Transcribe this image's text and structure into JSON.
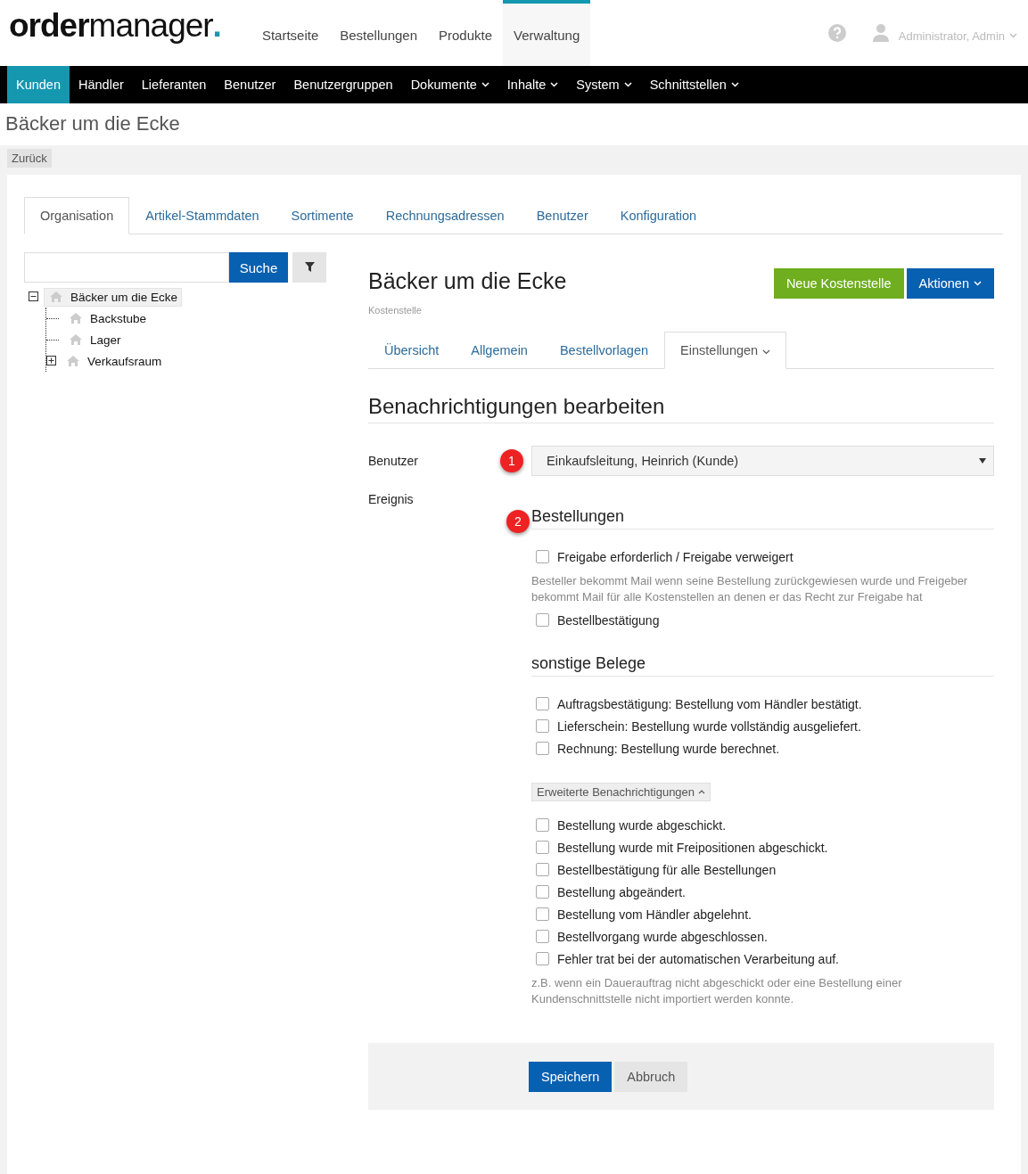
{
  "logo": {
    "bold": "order",
    "light": "manager",
    "dot": "."
  },
  "top_nav": [
    {
      "label": "Startseite",
      "selected": false
    },
    {
      "label": "Bestellungen",
      "selected": false
    },
    {
      "label": "Produkte",
      "selected": false
    },
    {
      "label": "Verwaltung",
      "selected": true
    }
  ],
  "user_menu": {
    "label": "Administrator, Admin"
  },
  "sub_nav": [
    {
      "label": "Kunden",
      "selected": true,
      "dropdown": false
    },
    {
      "label": "Händler",
      "selected": false,
      "dropdown": false
    },
    {
      "label": "Lieferanten",
      "selected": false,
      "dropdown": false
    },
    {
      "label": "Benutzer",
      "selected": false,
      "dropdown": false
    },
    {
      "label": "Benutzergruppen",
      "selected": false,
      "dropdown": false
    },
    {
      "label": "Dokumente",
      "selected": false,
      "dropdown": true
    },
    {
      "label": "Inhalte",
      "selected": false,
      "dropdown": true
    },
    {
      "label": "System",
      "selected": false,
      "dropdown": true
    },
    {
      "label": "Schnittstellen",
      "selected": false,
      "dropdown": true
    }
  ],
  "page_title": "Bäcker um die Ecke",
  "back_button": "Zurück",
  "tabs": [
    {
      "label": "Organisation",
      "selected": true
    },
    {
      "label": "Artikel-Stammdaten",
      "selected": false
    },
    {
      "label": "Sortimente",
      "selected": false
    },
    {
      "label": "Rechnungsadressen",
      "selected": false
    },
    {
      "label": "Benutzer",
      "selected": false
    },
    {
      "label": "Konfiguration",
      "selected": false
    }
  ],
  "search": {
    "button": "Suche"
  },
  "tree": [
    {
      "label": "Bäcker um die Ecke",
      "selected": true,
      "expanded": true,
      "children": [
        {
          "label": "Backstube",
          "selected": false
        },
        {
          "label": "Lager",
          "selected": false
        },
        {
          "label": "Verkaufsraum",
          "selected": false,
          "expanded": false
        }
      ]
    }
  ],
  "detail": {
    "title": "Bäcker um die Ecke",
    "subtitle": "Kostenstelle",
    "buttons": [
      {
        "label": "Neue Kostenstelle",
        "kind": "success"
      },
      {
        "label": "Aktionen",
        "kind": "primary",
        "dropdown": true
      }
    ],
    "tabs": [
      {
        "label": "Übersicht",
        "selected": false,
        "dropdown": false
      },
      {
        "label": "Allgemein",
        "selected": false,
        "dropdown": false
      },
      {
        "label": "Bestellvorlagen",
        "selected": false,
        "dropdown": false
      },
      {
        "label": "Einstellungen",
        "selected": true,
        "dropdown": true
      }
    ],
    "section_title": "Benachrichtigungen bearbeiten",
    "user_label": "Benutzer",
    "user_badge": "1",
    "user_value": "Einkaufsleitung, Heinrich (Kunde)",
    "event_label": "Ereignis",
    "groups": [
      {
        "kind": "heading",
        "title": "Bestellungen",
        "badge": "2",
        "items": [
          {
            "kind": "checkbox",
            "label": "Freigabe erforderlich / Freigabe verweigert",
            "checked": false
          },
          {
            "kind": "hint",
            "text": "Besteller bekommt Mail wenn seine Bestellung zurückgewiesen wurde und Freigeber bekommt Mail für alle Kostenstellen an denen er das Recht zur Freigabe hat"
          },
          {
            "kind": "checkbox",
            "label": "Bestellbestätigung",
            "checked": false
          }
        ]
      },
      {
        "kind": "heading",
        "title": "sonstige Belege",
        "items": [
          {
            "kind": "checkbox",
            "label": "Auftragsbestätigung: Bestellung vom Händler bestätigt.",
            "checked": false
          },
          {
            "kind": "checkbox",
            "label": "Lieferschein: Bestellung wurde vollständig ausgeliefert.",
            "checked": false
          },
          {
            "kind": "checkbox",
            "label": "Rechnung: Bestellung wurde berechnet.",
            "checked": false
          }
        ]
      },
      {
        "kind": "toggle",
        "title": "Erweiterte Benachrichtigungen",
        "expanded": true,
        "items": [
          {
            "kind": "checkbox",
            "label": "Bestellung wurde abgeschickt.",
            "checked": false
          },
          {
            "kind": "checkbox",
            "label": "Bestellung wurde mit Freipositionen abgeschickt.",
            "checked": false
          },
          {
            "kind": "checkbox",
            "label": "Bestellbestätigung für alle Bestellungen",
            "checked": false
          },
          {
            "kind": "checkbox",
            "label": "Bestellung abgeändert.",
            "checked": false
          },
          {
            "kind": "checkbox",
            "label": "Bestellung vom Händler abgelehnt.",
            "checked": false
          },
          {
            "kind": "checkbox",
            "label": "Bestellvorgang wurde abgeschlossen.",
            "checked": false
          },
          {
            "kind": "checkbox",
            "label": "Fehler trat bei der automatischen Verarbeitung auf.",
            "checked": false
          },
          {
            "kind": "hint",
            "text": "z.B. wenn ein Dauerauftrag nicht abgeschickt oder eine Bestellung einer Kundenschnittstelle nicht importiert werden konnte."
          }
        ]
      }
    ],
    "footer_buttons": [
      {
        "label": "Speichern",
        "kind": "primary"
      },
      {
        "label": "Abbruch",
        "kind": "default"
      }
    ]
  }
}
